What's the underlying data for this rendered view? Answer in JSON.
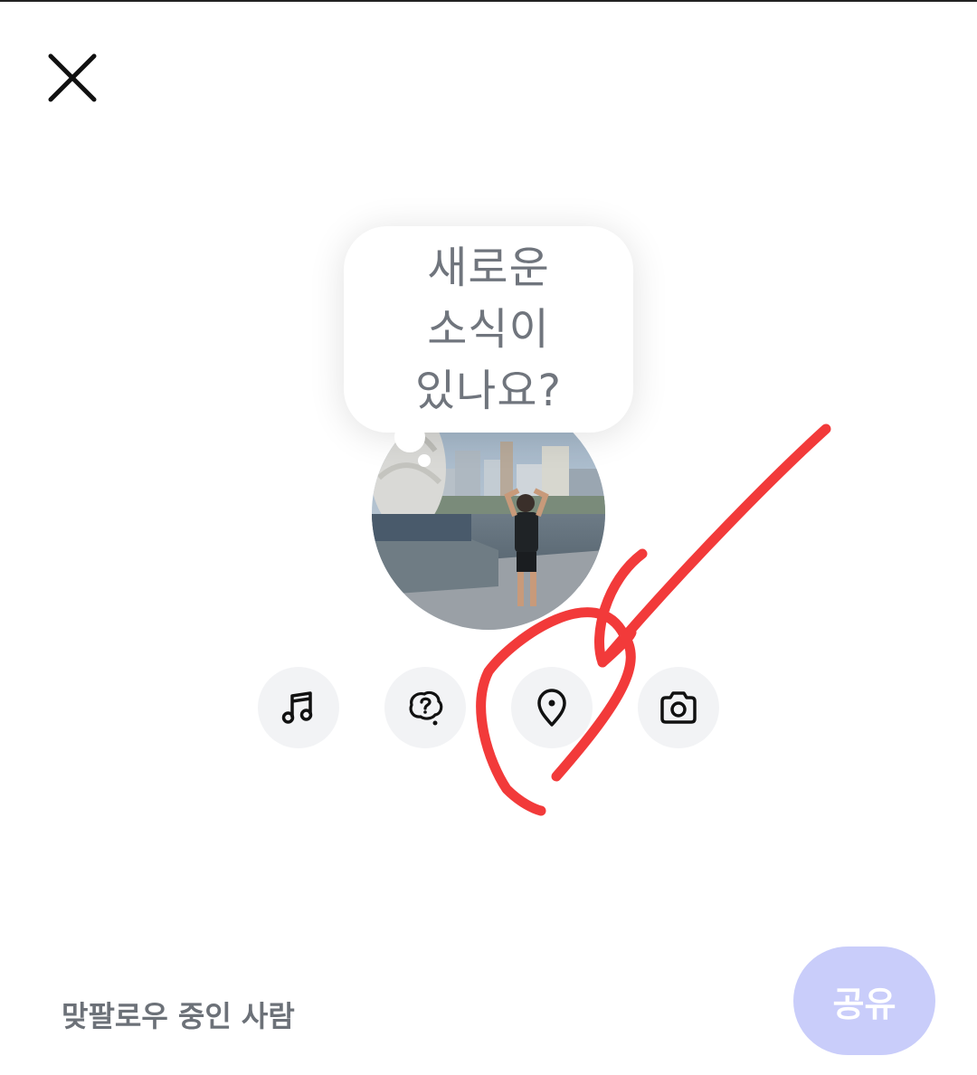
{
  "header": {
    "close_icon": "close-icon"
  },
  "composer": {
    "prompt_lines": [
      "새로운",
      "소식이",
      "있나요?"
    ]
  },
  "avatar": {
    "description_icon": "profile-photo"
  },
  "actions": [
    {
      "name": "music-button",
      "icon": "music-note-icon"
    },
    {
      "name": "question-button",
      "icon": "question-bubble-icon"
    },
    {
      "name": "location-button",
      "icon": "location-pin-icon"
    },
    {
      "name": "camera-button",
      "icon": "camera-icon"
    }
  ],
  "footer": {
    "audience_label": "맞팔로우 중인 사람",
    "share_label": "공유"
  },
  "colors": {
    "prompt_text": "#70757d",
    "action_bg": "#f2f3f5",
    "share_bg": "#c9cdfa",
    "annotation": "#f23a3a"
  }
}
